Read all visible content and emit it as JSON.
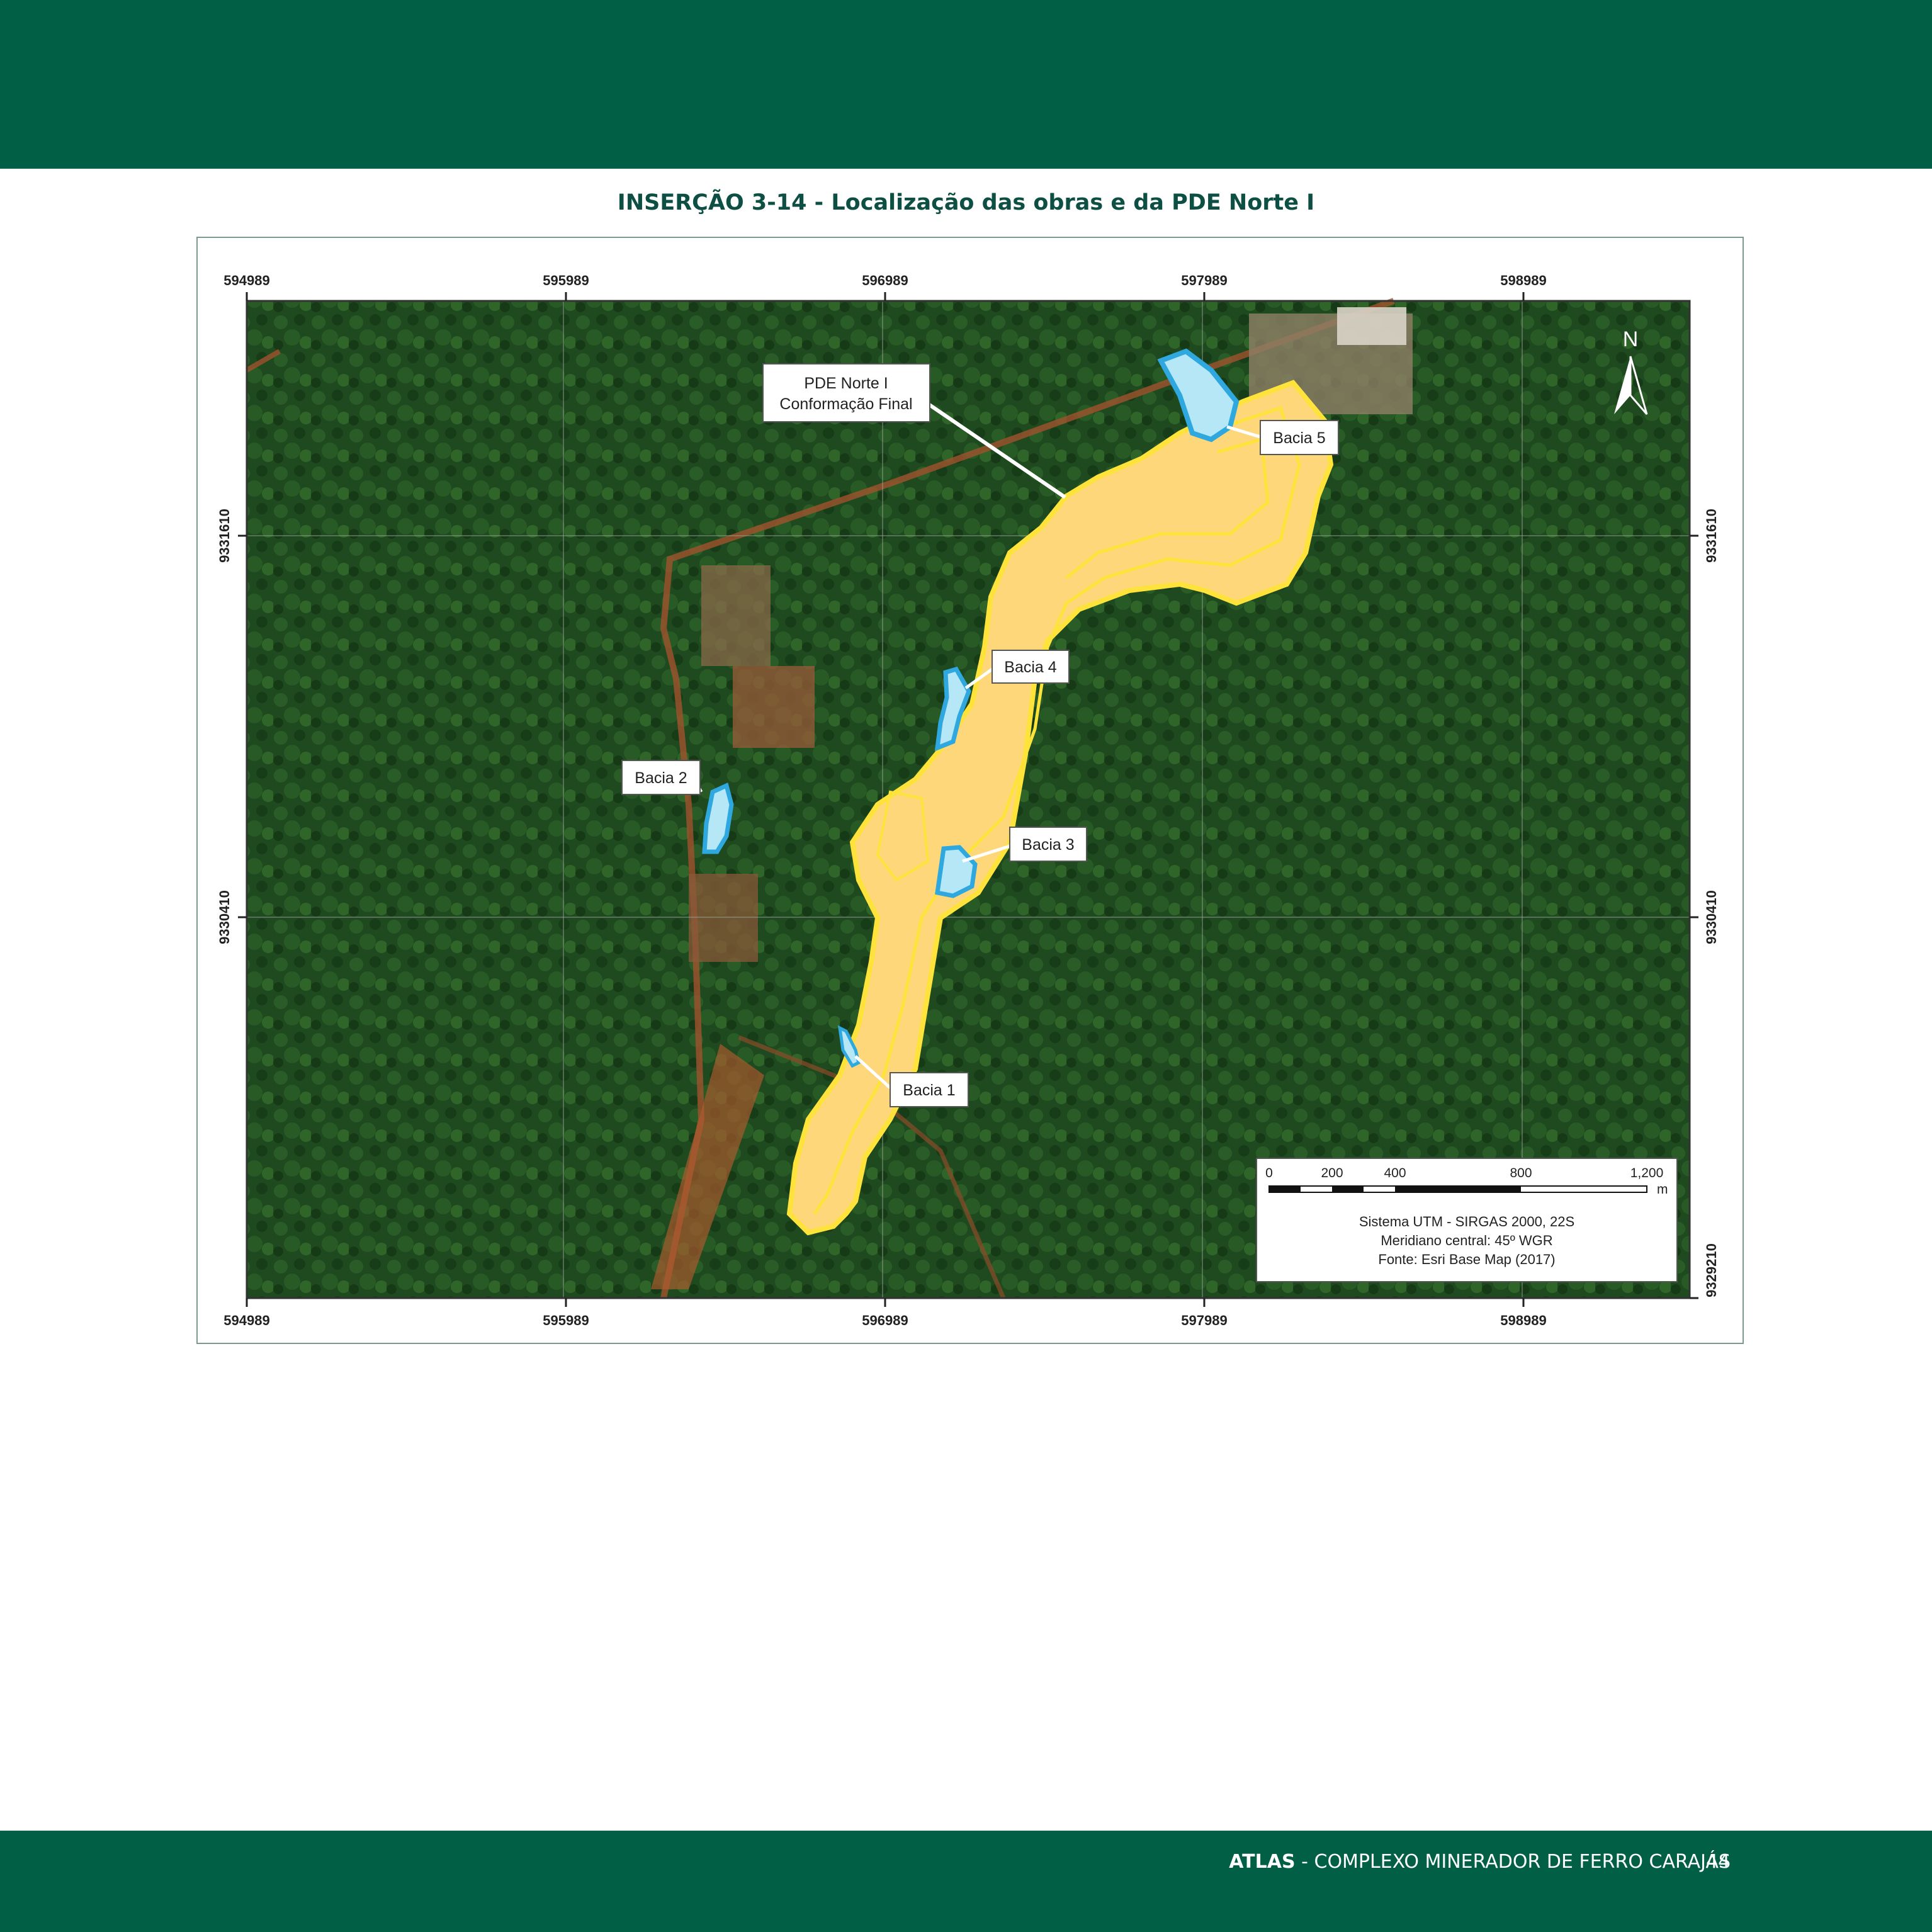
{
  "caption": "INSERÇÃO 3-14 - Localização das obras e da PDE Norte I",
  "map": {
    "top_ticks": [
      "594989",
      "595989",
      "596989",
      "597989",
      "598989"
    ],
    "bottom_ticks": [
      "594989",
      "595989",
      "596989",
      "597989",
      "598989"
    ],
    "left_ticks": [
      "9331610",
      "9330410"
    ],
    "right_ticks": [
      "9331610",
      "9330410",
      "9329210"
    ],
    "pile_label_line1": "PDE Norte I",
    "pile_label_line2": "Conformação Final",
    "basins": [
      "Bacia 1",
      "Bacia 2",
      "Bacia 3",
      "Bacia 4",
      "Bacia 5"
    ],
    "north": "N",
    "scale_labels": [
      "0",
      "200",
      "400",
      "800",
      "1,200"
    ],
    "scale_unit": "m",
    "legend_line1": "Sistema UTM - SIRGAS 2000, 22S",
    "legend_line2": "Meridiano central: 45º WGR",
    "legend_line3": "Fonte: Esri Base Map (2017)",
    "colors": {
      "pile_fill": "#fdd77a",
      "pile_stroke": "#ffe23a",
      "basin_fill": "#b5e7f7",
      "basin_stroke": "#2fa8df",
      "forest": "#1f4a1f"
    }
  },
  "footer": {
    "brand": "ATLAS",
    "title": " - COMPLEXO MINERADOR DE FERRO CARAJÁS",
    "page": "44"
  }
}
